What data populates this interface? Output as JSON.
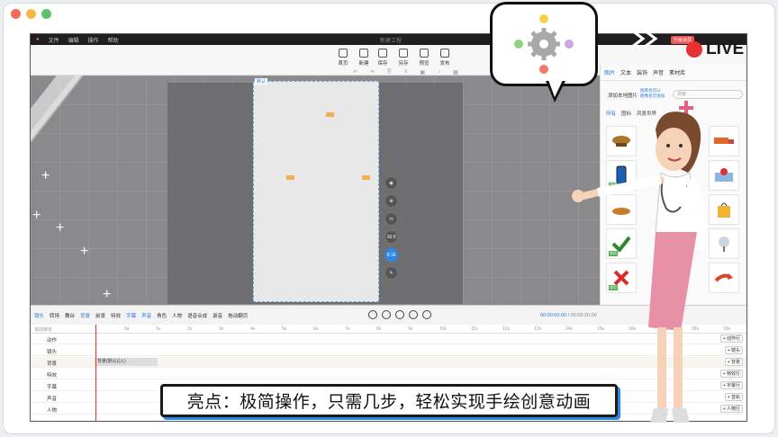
{
  "window": {
    "dot_colors": [
      "#f26b5b",
      "#f5b94a",
      "#5cc26b"
    ],
    "live_label": "LIVE",
    "live_color": "#e83030"
  },
  "app": {
    "title": "新建工程",
    "menu": [
      "文件",
      "编辑",
      "操作",
      "帮助"
    ],
    "upgrade_label": "升级会员",
    "ribbon": [
      {
        "label": "首页",
        "icon": "home-icon"
      },
      {
        "label": "新建",
        "icon": "new-file-icon"
      },
      {
        "label": "保存",
        "icon": "save-icon"
      },
      {
        "label": "另存",
        "icon": "save-as-icon"
      },
      {
        "label": "预览",
        "icon": "preview-icon"
      },
      {
        "label": "发布",
        "icon": "publish-icon"
      }
    ],
    "stage_label": "默认",
    "view_tools": [
      "camera-icon",
      "zoom-icon",
      "lock-icon",
      "16:9",
      "9:16",
      "edit-icon"
    ],
    "view_active": "9:16"
  },
  "panel": {
    "tabs": [
      "图片",
      "文本",
      "装饰",
      "声音",
      "素材库"
    ],
    "active_tab": "图片",
    "add_local_label": "添加本地图片",
    "promo_label_1": "图库也可以",
    "promo_label_2": "图像也可添加",
    "search_placeholder": "搜索",
    "categories": [
      "所有",
      "图标",
      "风景世界"
    ],
    "active_category": "所有",
    "tile_tag": "商用"
  },
  "controls": {
    "tools": [
      "镜头",
      "转场",
      "舞台",
      "背景",
      "前景",
      "特效",
      "字幕",
      "声音",
      "角色",
      "人物",
      "语音合成",
      "录音",
      "拖动翻页"
    ],
    "active_tools": [
      "镜头",
      "背景",
      "字幕",
      "声音"
    ],
    "timecode_current": "00:00:00.00",
    "timecode_total": "00:00:20.00",
    "scale_label": "拆尺"
  },
  "timeline": {
    "ruler": [
      "0s",
      "1s",
      "2s",
      "3s",
      "4s",
      "5s",
      "6s",
      "7s",
      "8s",
      "9s",
      "10s",
      "11s",
      "12s",
      "13s",
      "14s",
      "15s",
      "16s",
      "17s",
      "18s",
      "19s"
    ],
    "header_label": "滚动锁定",
    "tracks": [
      {
        "name": "动作",
        "add": "+ 动作行"
      },
      {
        "name": "镜头",
        "add": "+ 镜头"
      },
      {
        "name": "背景",
        "add": "+ 背景"
      },
      {
        "name": "特效",
        "add": "+ 特效行"
      },
      {
        "name": "字幕",
        "add": "+ 字幕行"
      },
      {
        "name": "声音",
        "add": "+ 音轨"
      },
      {
        "name": "人物",
        "add": "+ 人物行"
      }
    ],
    "bg_block": "背景(默认)(入)"
  },
  "caption": {
    "text": "亮点：极简操作，只需几步，轻松实现手绘创意动画"
  },
  "colors": {
    "accent": "#2e86e6",
    "caption_shadow": "#2e86e6"
  }
}
